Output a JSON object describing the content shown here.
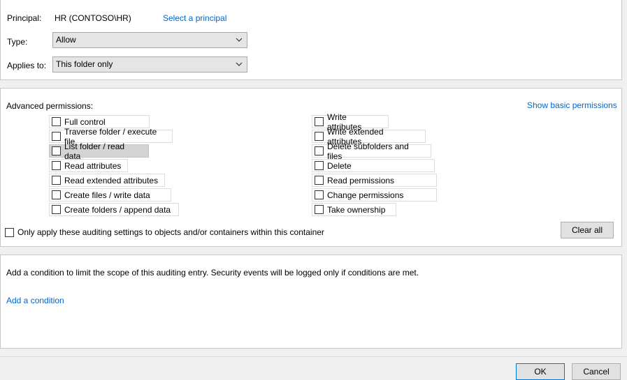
{
  "principal": {
    "label": "Principal:",
    "value": "HR (CONTOSO\\HR)",
    "select_link": "Select a principal"
  },
  "type": {
    "label": "Type:",
    "value": "Allow"
  },
  "applies_to": {
    "label": "Applies to:",
    "value": "This folder only"
  },
  "advanced": {
    "label": "Advanced permissions:",
    "show_basic_link": "Show basic permissions",
    "left": [
      {
        "label": "Full control",
        "checked": false
      },
      {
        "label": "Traverse folder / execute file",
        "checked": false
      },
      {
        "label": "List folder / read data",
        "checked": false
      },
      {
        "label": "Read attributes",
        "checked": false
      },
      {
        "label": "Read extended attributes",
        "checked": false
      },
      {
        "label": "Create files / write data",
        "checked": false
      },
      {
        "label": "Create folders / append data",
        "checked": false
      }
    ],
    "right": [
      {
        "label": "Write attributes",
        "checked": false
      },
      {
        "label": "Write extended attributes",
        "checked": false
      },
      {
        "label": "Delete subfolders and files",
        "checked": false
      },
      {
        "label": "Delete",
        "checked": false
      },
      {
        "label": "Read permissions",
        "checked": false
      },
      {
        "label": "Change permissions",
        "checked": false
      },
      {
        "label": "Take ownership",
        "checked": false
      }
    ],
    "only_apply_label": "Only apply these auditing settings to objects and/or containers within this container",
    "clear_all": "Clear all"
  },
  "condition": {
    "description": "Add a condition to limit the scope of this auditing entry. Security events will be logged only if conditions are met.",
    "add_link": "Add a condition"
  },
  "footer": {
    "ok": "OK",
    "cancel": "Cancel"
  }
}
